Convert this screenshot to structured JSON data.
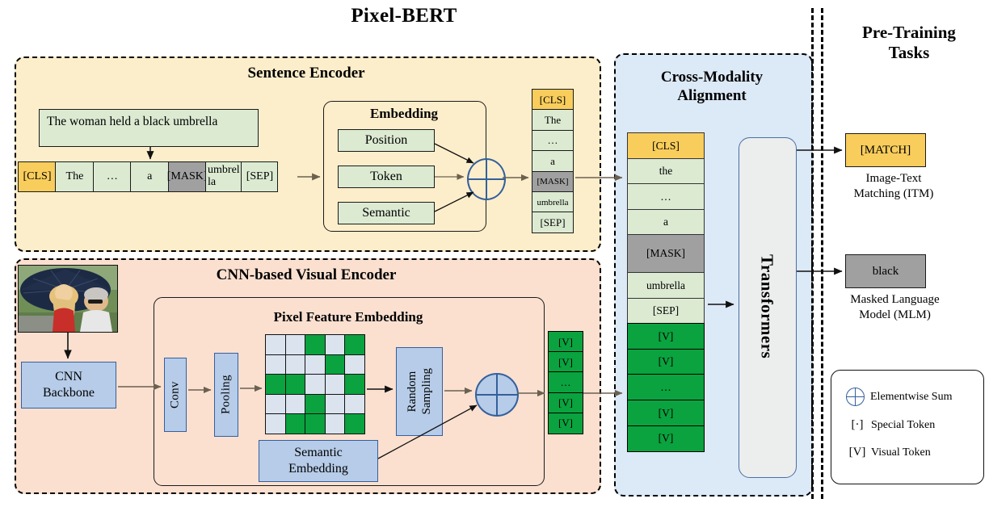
{
  "title": "Pixel-BERT",
  "panels": {
    "sentence_encoder": "Sentence Encoder",
    "visual_encoder": "CNN-based Visual Encoder",
    "cross_modality": "Cross-Modality\nAlignment",
    "cross_modality_line1": "Cross-Modality",
    "cross_modality_line2": "Alignment",
    "pretraining_tasks_line1": "Pre-Training",
    "pretraining_tasks_line2": "Tasks"
  },
  "sentence_encoder": {
    "caption": "The woman held a black umbrella",
    "tokens": [
      {
        "text": "[CLS]",
        "type": "special"
      },
      {
        "text": "The",
        "type": "word"
      },
      {
        "text": "…",
        "type": "word"
      },
      {
        "text": "a",
        "type": "word"
      },
      {
        "text": "[MASK]",
        "type": "mask"
      },
      {
        "text": "umbrella",
        "type": "word"
      },
      {
        "text": "[SEP]",
        "type": "word"
      }
    ],
    "embedding": {
      "title": "Embedding",
      "items": [
        "Position",
        "Token",
        "Semantic"
      ]
    },
    "output_tokens": [
      {
        "text": "[CLS]",
        "type": "special"
      },
      {
        "text": "The",
        "type": "word"
      },
      {
        "text": "…",
        "type": "word"
      },
      {
        "text": "a",
        "type": "word"
      },
      {
        "text": "[MASK]",
        "type": "mask"
      },
      {
        "text": "umbrella",
        "type": "word"
      },
      {
        "text": "[SEP]",
        "type": "word"
      }
    ]
  },
  "visual_encoder": {
    "backbone_label": "CNN\nBackbone",
    "backbone_line1": "CNN",
    "backbone_line2": "Backbone",
    "pixel_feature_embedding": "Pixel Feature Embedding",
    "conv_label": "Conv",
    "pooling_label": "Pooling",
    "random_sampling_line1": "Random",
    "random_sampling_line2": "Sampling",
    "semantic_embedding_line1": "Semantic",
    "semantic_embedding_line2": "Embedding",
    "feature_grid": [
      [
        0,
        0,
        1,
        0,
        1
      ],
      [
        0,
        0,
        0,
        1,
        0
      ],
      [
        1,
        1,
        0,
        0,
        1
      ],
      [
        0,
        0,
        1,
        0,
        0
      ],
      [
        0,
        1,
        1,
        0,
        1
      ]
    ],
    "visual_tokens": [
      "[V]",
      "[V]",
      "…",
      "[V]",
      "[V]"
    ]
  },
  "cross_modality": {
    "sequence": [
      {
        "text": "[CLS]",
        "type": "special"
      },
      {
        "text": "the",
        "type": "word"
      },
      {
        "text": "…",
        "type": "word"
      },
      {
        "text": "a",
        "type": "word"
      },
      {
        "text": "[MASK]",
        "type": "mask"
      },
      {
        "text": "umbrella",
        "type": "word"
      },
      {
        "text": "[SEP]",
        "type": "word"
      },
      {
        "text": "[V]",
        "type": "visual"
      },
      {
        "text": "[V]",
        "type": "visual"
      },
      {
        "text": "…",
        "type": "visual"
      },
      {
        "text": "[V]",
        "type": "visual"
      },
      {
        "text": "[V]",
        "type": "visual"
      }
    ],
    "transformers_label": "Transformers"
  },
  "pretraining": {
    "itm": {
      "token": "[MATCH]",
      "caption_line1": "Image-Text",
      "caption_line2": "Matching (ITM)"
    },
    "mlm": {
      "token": "black",
      "caption_line1": "Masked Language",
      "caption_line2": "Model (MLM)"
    }
  },
  "legend": {
    "items": [
      {
        "symbol": "⊕",
        "label": "Elementwise Sum"
      },
      {
        "symbol": "[·]",
        "label": "Special Token"
      },
      {
        "symbol": "[V]",
        "label": "Visual Token"
      }
    ]
  },
  "colors": {
    "sentence_panel": "#fdeecb",
    "visual_panel": "#fbe0d0",
    "cross_modality_panel": "#dce9f7",
    "special_token": "#f8cd5c",
    "mask_token": "#a0a0a0",
    "word_token": "#dcead2",
    "visual_token": "#0aa33f",
    "module_blue": "#b6cce8"
  }
}
